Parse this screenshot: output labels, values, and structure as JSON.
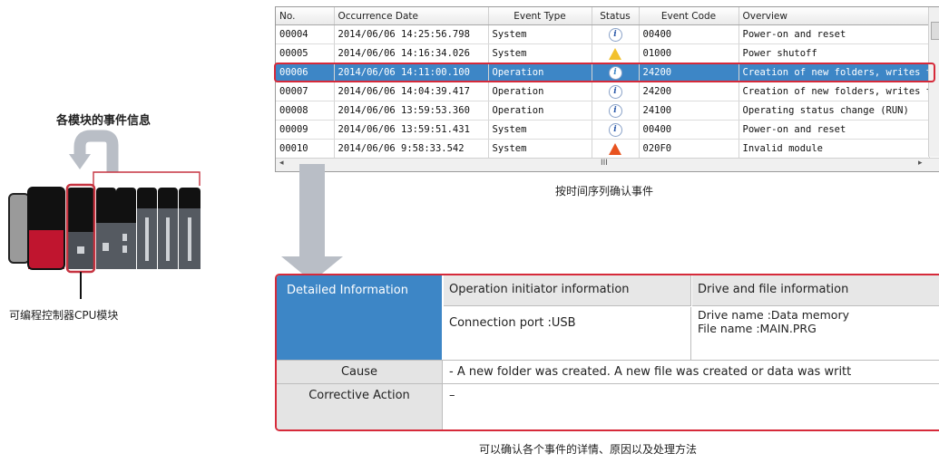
{
  "diagram": {
    "title": "各模块的事件信息",
    "caption": "可编程控制器CPU模块"
  },
  "event_log": {
    "columns": [
      "No.",
      "Occurrence Date",
      "Event Type",
      "Status",
      "Event Code",
      "Overview"
    ],
    "rows": [
      {
        "no": "00004",
        "date": "2014/06/06 14:25:56.798",
        "type": "System",
        "status": "info-icon",
        "code": "00400",
        "overview": "Power-on and reset"
      },
      {
        "no": "00005",
        "date": "2014/06/06 14:16:34.026",
        "type": "System",
        "status": "warning-icon",
        "code": "01000",
        "overview": "Power shutoff"
      },
      {
        "no": "00006",
        "date": "2014/06/06 14:11:00.100",
        "type": "Operation",
        "status": "info-icon",
        "code": "24200",
        "overview": "Creation of new folders, writes to fil",
        "selected": true
      },
      {
        "no": "00007",
        "date": "2014/06/06 14:04:39.417",
        "type": "Operation",
        "status": "info-icon",
        "code": "24200",
        "overview": "Creation of new folders, writes to fil"
      },
      {
        "no": "00008",
        "date": "2014/06/06 13:59:53.360",
        "type": "Operation",
        "status": "info-icon",
        "code": "24100",
        "overview": "Operating status change (RUN)"
      },
      {
        "no": "00009",
        "date": "2014/06/06 13:59:51.431",
        "type": "System",
        "status": "info-icon",
        "code": "00400",
        "overview": "Power-on and reset"
      },
      {
        "no": "00010",
        "date": "2014/06/06 9:58:33.542",
        "type": "System",
        "status": "error-icon",
        "code": "020F0",
        "overview": "Invalid module"
      }
    ],
    "scroll_glyphs": {
      "left": "◂",
      "middle": "III",
      "right": "▸"
    },
    "caption": "按时间序列确认事件"
  },
  "detail": {
    "header": "Detailed Information",
    "col1_title": "Operation initiator information",
    "col2_title": "Drive and file information",
    "col1_value": "Connection port :USB",
    "drive_name": "Drive name :Data memory",
    "file_name": "File name :MAIN.PRG",
    "cause_label": "Cause",
    "cause_value": "- A new folder was created. A new file was created or data was writt",
    "action_label": "Corrective Action",
    "action_value": "–",
    "caption": "可以确认各个事件的详情、原因以及处理方法"
  },
  "colors": {
    "accent_red": "#d62a3a",
    "selection_blue": "#3d86c6",
    "arrow_gray": "#b9bec6"
  }
}
